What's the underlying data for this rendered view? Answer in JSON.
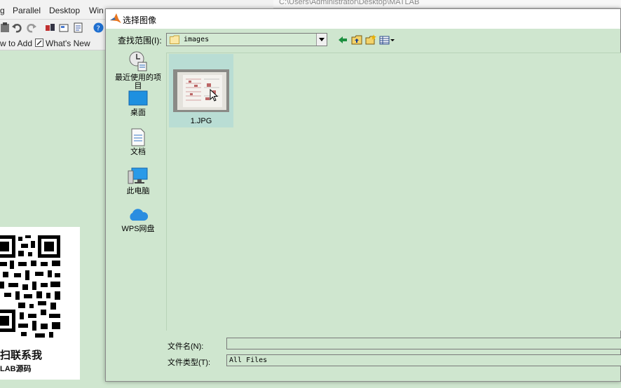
{
  "background_app": {
    "menus": [
      "g",
      "Parallel",
      "Desktop",
      "Win"
    ],
    "shortcuts": {
      "add_label": "w to Add",
      "whats_new_label": "What's New"
    },
    "title_strip": "C:\\Users\\Administrator\\Desktop\\MATLAB"
  },
  "promo": {
    "line1": "扫联系我",
    "line2": "LAB源码"
  },
  "dialog": {
    "title": "选择图像",
    "look_in_label": "查找范围(I):",
    "look_in_value": "images",
    "places": [
      {
        "label": "最近使用的项目",
        "icon": "recent-items-icon"
      },
      {
        "label": "桌面",
        "icon": "desktop-icon"
      },
      {
        "label": "文档",
        "icon": "documents-icon"
      },
      {
        "label": "此电脑",
        "icon": "this-pc-icon"
      },
      {
        "label": "WPS网盘",
        "icon": "cloud-drive-icon"
      }
    ],
    "files": [
      {
        "name": "1.JPG"
      }
    ],
    "file_name_label": "文件名(N):",
    "file_name_value": "",
    "file_type_label": "文件类型(T):",
    "file_type_value": "All Files"
  },
  "colors": {
    "dialog_bg": "#cfe6cf",
    "selection": "#b9ddd4",
    "matlab_orange": "#e87722",
    "desktop_blue": "#1e90e0"
  }
}
